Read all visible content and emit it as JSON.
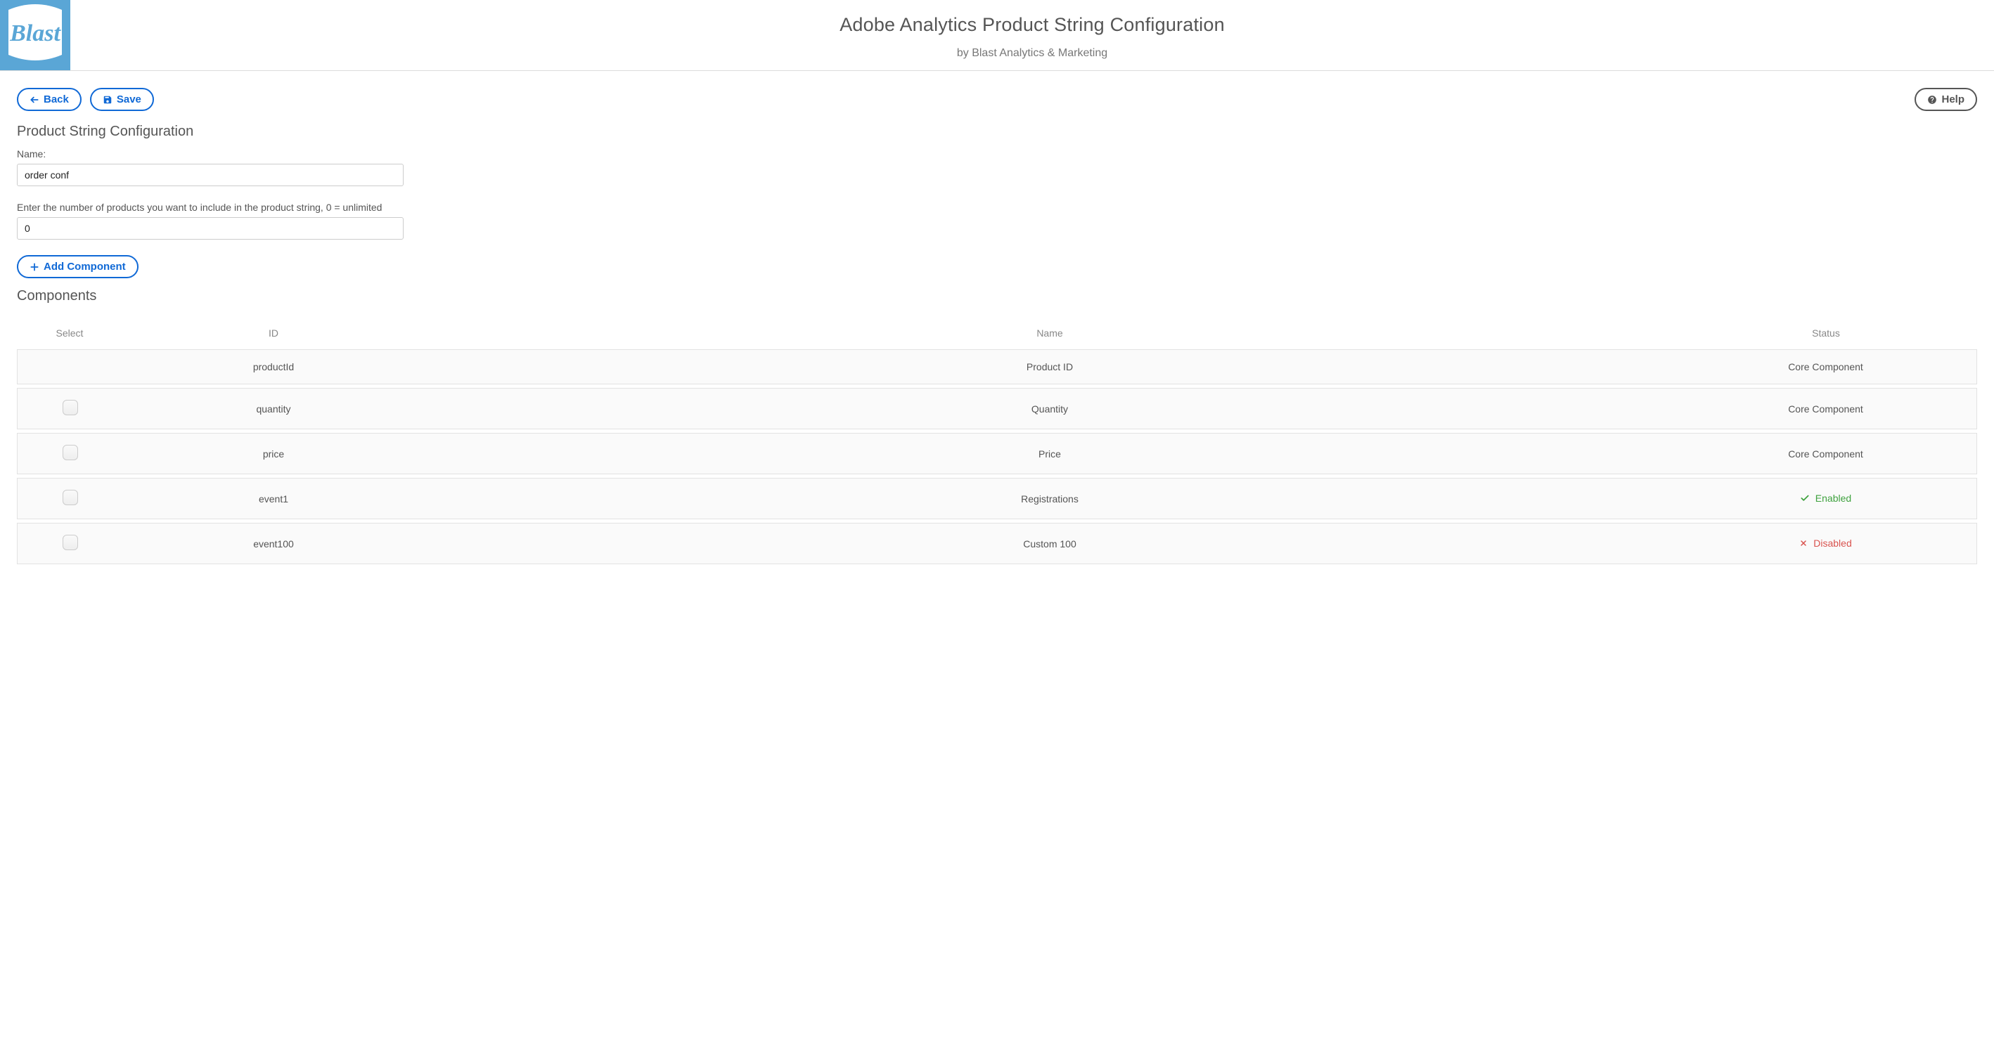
{
  "header": {
    "title": "Adobe Analytics Product String Configuration",
    "subtitle": "by Blast Analytics & Marketing",
    "logo_text": "Blast"
  },
  "toolbar": {
    "back_label": "Back",
    "save_label": "Save",
    "help_label": "Help"
  },
  "config": {
    "section_title": "Product String Configuration",
    "name_label": "Name:",
    "name_value": "order conf",
    "product_count_label": "Enter the number of products you want to include in the product string, 0 = unlimited",
    "product_count_value": "0",
    "add_component_label": "Add Component"
  },
  "components": {
    "section_title": "Components",
    "columns": {
      "select": "Select",
      "id": "ID",
      "name": "Name",
      "status": "Status"
    },
    "rows": [
      {
        "has_checkbox": false,
        "id": "productId",
        "name": "Product ID",
        "status_type": "core",
        "status_text": "Core Component"
      },
      {
        "has_checkbox": true,
        "id": "quantity",
        "name": "Quantity",
        "status_type": "core",
        "status_text": "Core Component"
      },
      {
        "has_checkbox": true,
        "id": "price",
        "name": "Price",
        "status_type": "core",
        "status_text": "Core Component"
      },
      {
        "has_checkbox": true,
        "id": "event1",
        "name": "Registrations",
        "status_type": "enabled",
        "status_text": "Enabled"
      },
      {
        "has_checkbox": true,
        "id": "event100",
        "name": "Custom 100",
        "status_type": "disabled",
        "status_text": "Disabled"
      }
    ]
  }
}
